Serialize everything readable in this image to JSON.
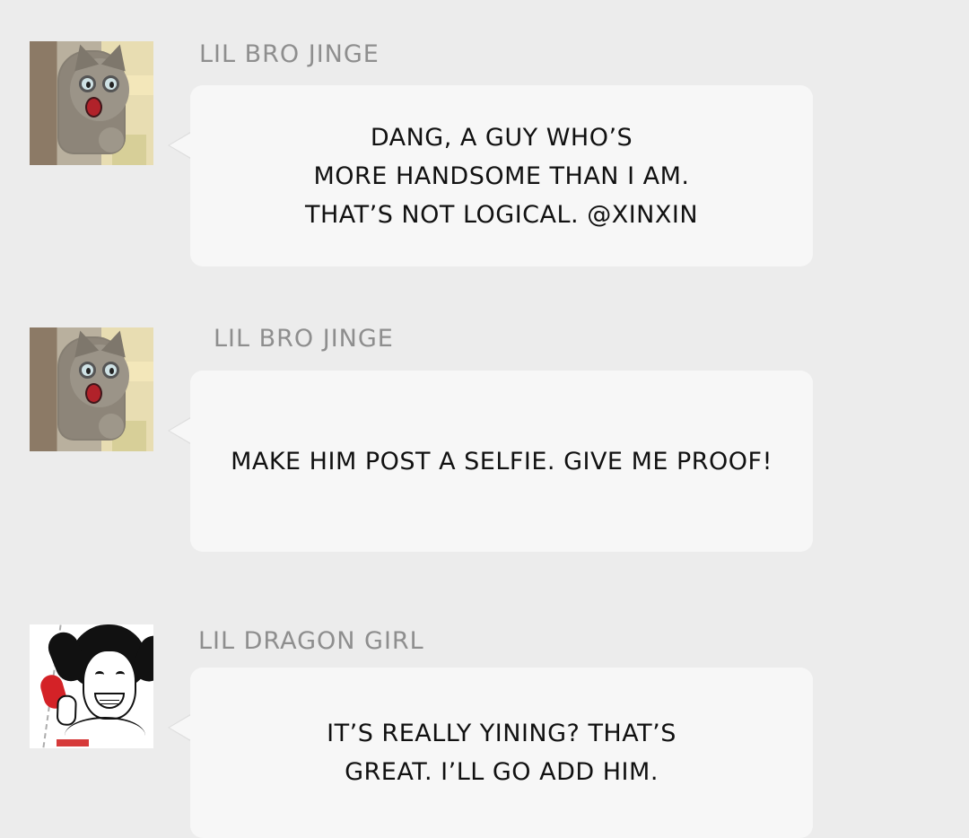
{
  "messages": [
    {
      "sender": "LIL BRO JINGE",
      "avatar_icon": "cat-avatar-icon",
      "text_lines": [
        "DANG, A GUY WHO’S",
        "MORE HANDSOME THAN I AM.",
        "THAT’S NOT LOGICAL. @XINXIN"
      ]
    },
    {
      "sender": "LIL BRO JINGE",
      "avatar_icon": "cat-avatar-icon",
      "text_lines": [
        "MAKE HIM POST A SELFIE. GIVE ME PROOF!"
      ]
    },
    {
      "sender": "LIL DRAGON GIRL",
      "avatar_icon": "girl-avatar-icon",
      "text_lines": [
        "IT’S REALLY YINING? THAT’S",
        "GREAT. I’LL GO ADD HIM."
      ]
    }
  ],
  "colors": {
    "background": "#ececec",
    "bubble": "#f7f7f7",
    "sender": "#8e8e8e",
    "text": "#111111"
  }
}
